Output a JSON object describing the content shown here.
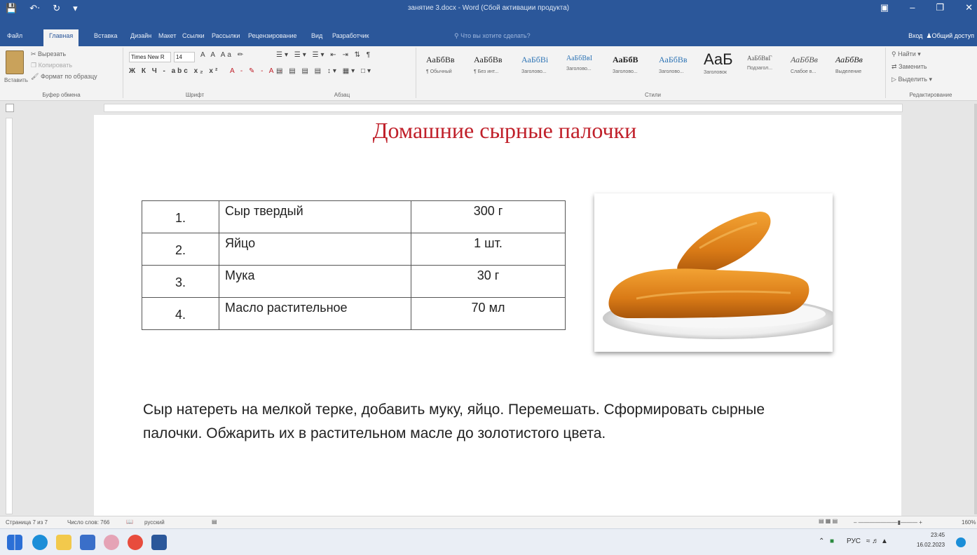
{
  "window": {
    "title": "занятие 3.docx - Word (Сбой активации продукта)"
  },
  "tabs": [
    "Файл",
    "Главная",
    "Вставка",
    "Дизайн",
    "Макет",
    "Ссылки",
    "Рассылки",
    "Рецензирование",
    "Вид",
    "Разработчик"
  ],
  "tell_me": "Что вы хотите сделать?",
  "account": {
    "user": "Вход",
    "share": "Общий доступ"
  },
  "ribbon": {
    "clipboard": {
      "paste": "Вставить",
      "cut": "Вырезать",
      "copy": "Копировать",
      "format_painter": "Формат по образцу",
      "label": "Буфер обмена"
    },
    "font": {
      "name": "Times New R",
      "size": "14",
      "label": "Шрифт"
    },
    "paragraph": {
      "label": "Абзац"
    },
    "styles": {
      "label": "Стили",
      "items": [
        {
          "preview": "АаБбВв",
          "name": "¶ Обычный"
        },
        {
          "preview": "АаБбВв",
          "name": "¶ Без инт..."
        },
        {
          "preview": "АаБбВі",
          "name": "Заголово..."
        },
        {
          "preview": "АаБбВвІ",
          "name": "Заголово..."
        },
        {
          "preview": "АаБбВ",
          "name": "Заголово..."
        },
        {
          "preview": "АаБбВв",
          "name": "Заголово..."
        },
        {
          "preview": "АаБ",
          "name": "Заголовок"
        },
        {
          "preview": "АаБбВвГ",
          "name": "Подзагол..."
        },
        {
          "preview": "АаБбВв",
          "name": "Слабое в..."
        },
        {
          "preview": "АаБбВв",
          "name": "Выделение"
        }
      ]
    },
    "editing": {
      "find": "Найти",
      "replace": "Заменить",
      "select": "Выделить",
      "label": "Редактирование"
    }
  },
  "document": {
    "title": "Домашние сырные палочки",
    "ingredients": [
      {
        "num": "1.",
        "name": "Сыр твердый",
        "qty": "300 г"
      },
      {
        "num": "2.",
        "name": "Яйцо",
        "qty": "1 шт."
      },
      {
        "num": "3.",
        "name": "Мука",
        "qty": "30 г"
      },
      {
        "num": "4.",
        "name": "Масло растительное",
        "qty": "70 мл"
      }
    ],
    "instructions": "Сыр натереть на мелкой терке, добавить муку, яйцо. Перемешать. Сформировать сырные палочки. Обжарить их в растительном масле до золотистого цвета."
  },
  "status": {
    "page": "Страница 7 из 7",
    "words": "Число слов: 766",
    "language": "русский",
    "zoom": "160%"
  },
  "taskbar": {
    "lang": "РУС",
    "time": "23:45",
    "date": "16.02.2023"
  },
  "colors": {
    "word_blue": "#2b579a",
    "title_red": "#c0202a"
  }
}
